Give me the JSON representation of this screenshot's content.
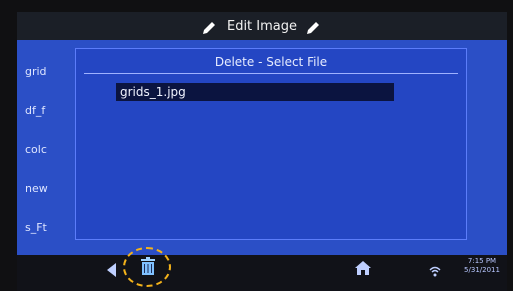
{
  "header": {
    "title": "Edit Image",
    "left_icon": "pencil-icon",
    "right_icon": "pencil-icon"
  },
  "sidebar": {
    "files": [
      "grid",
      "df_f",
      "colc",
      "new",
      "s_Ft"
    ]
  },
  "dialog": {
    "title": "Delete - Select File",
    "files": [
      "grids_1.jpg"
    ]
  },
  "footer": {
    "back_icon": "back-arrow-icon",
    "delete_icon": "trash-icon",
    "home_icon": "home-icon",
    "wifi_icon": "wifi-icon",
    "time": "7:15 PM",
    "date": "5/31/2011"
  },
  "colors": {
    "main_bg": "#2b4fc6",
    "dialog_bg": "#2446c3",
    "selected_bg": "#0b1440",
    "highlight_ring": "#f3b21a"
  }
}
